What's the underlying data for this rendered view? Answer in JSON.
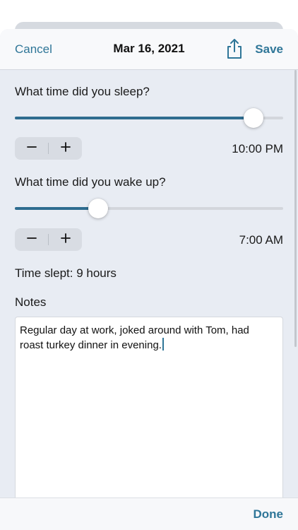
{
  "nav": {
    "cancel_label": "Cancel",
    "title": "Mar 16, 2021",
    "save_label": "Save",
    "share_icon": "share-icon"
  },
  "sleep": {
    "question": "What time did you sleep?",
    "slider_value": 0.89,
    "time": "10:00 PM",
    "decrement_icon": "minus-icon",
    "increment_icon": "plus-icon"
  },
  "wake": {
    "question": "What time did you wake up?",
    "slider_value": 0.31,
    "time": "7:00 AM",
    "decrement_icon": "minus-icon",
    "increment_icon": "plus-icon"
  },
  "summary": {
    "time_slept": "Time slept: 9 hours"
  },
  "notes": {
    "label": "Notes",
    "value": "Regular day at work, joked around with Tom, had roast turkey dinner in evening."
  },
  "keyboard_toolbar": {
    "done_label": "Done"
  },
  "colors": {
    "accent": "#2f7698",
    "slider_fill": "#2e6c8f",
    "sheet_background": "#e8ecf3",
    "stepper_background": "#d8dce3"
  }
}
